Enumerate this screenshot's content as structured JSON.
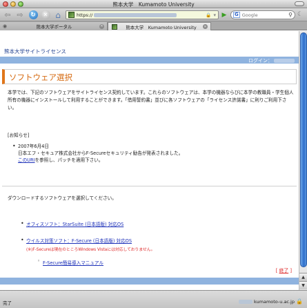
{
  "window": {
    "title": "熊本大学　Kumamoto University"
  },
  "toolbar": {
    "url_prefix": "https://",
    "search_engine_label": "G",
    "search_placeholder": "Google"
  },
  "tabs": [
    {
      "label": "熊本大学ポータル",
      "active": false
    },
    {
      "label": "熊本大学　Kumamoto University",
      "active": true
    }
  ],
  "page": {
    "site_name": "熊本大学サイトライセンス",
    "login_label": "ログイン：",
    "title": "ソフトウェア選択",
    "intro": "本学では、下記のソフトウェアをサイトライセンス契約しています。これらのソフトウェアは、本学の機器ならびに本学の教職員・学生個人所有の機器にインストールして利用することができます。「借用誓約書」並びに各ソフトウェアの「ライセンス許諾書」に則りご利用下さい。",
    "notice_heading": "[お知らせ]",
    "notices": [
      {
        "date": "2007年6月4日",
        "line1": "日本エフ・セキュア株式会社からF-Secureセキュリティ勧告が発表されました。",
        "link_text": "このURI",
        "line2_rest": "を参照し、パッチを適用下さい。"
      }
    ],
    "select_prompt": "ダウンロードするソフトウェアを選択してください。",
    "downloads": [
      {
        "label": "オフィスソフト：StarSuite (日本語版) 対応OS"
      },
      {
        "label": "ウイルス対策ソフト：F-Secure (日本語版) 対応OS"
      }
    ],
    "warning": "(※)F-Secureは現在のところWindows Vistaには対応しておりません。",
    "manual_link": "F-Secure簡易導入マニュアル",
    "logout_open": "[ ",
    "logout_label": "終了",
    "logout_close": " ]"
  },
  "statusbar": {
    "status": "完了",
    "domain": "kumamoto-u.ac.jp"
  },
  "colors": {
    "accent_orange": "#d5680e",
    "bar_blue": "#8fb3df",
    "link_blue": "#1b2fb8",
    "warning_red": "#dd2222"
  }
}
